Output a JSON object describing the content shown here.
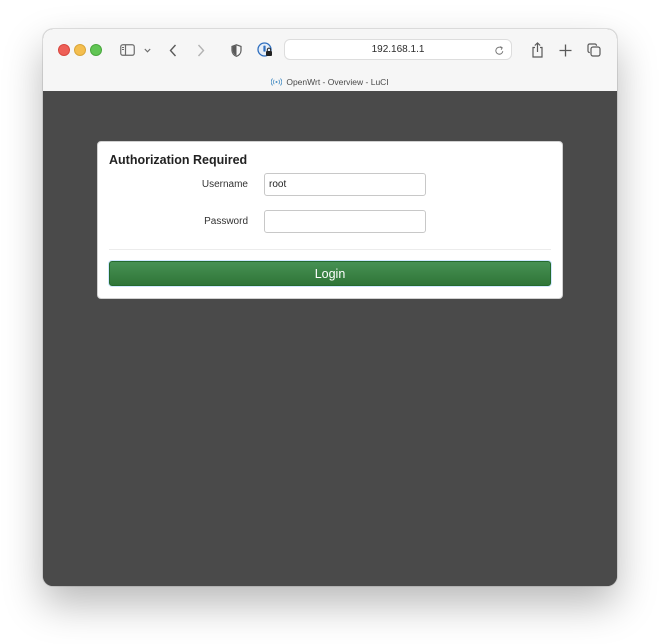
{
  "browser": {
    "address": "192.168.1.1",
    "tab_title": "OpenWrt - Overview - LuCI"
  },
  "login": {
    "heading": "Authorization Required",
    "username_label": "Username",
    "username_value": "root",
    "password_label": "Password",
    "password_value": "",
    "submit_label": "Login"
  },
  "colors": {
    "page_background": "#4a4a4a",
    "button_green": "#3a8345"
  }
}
